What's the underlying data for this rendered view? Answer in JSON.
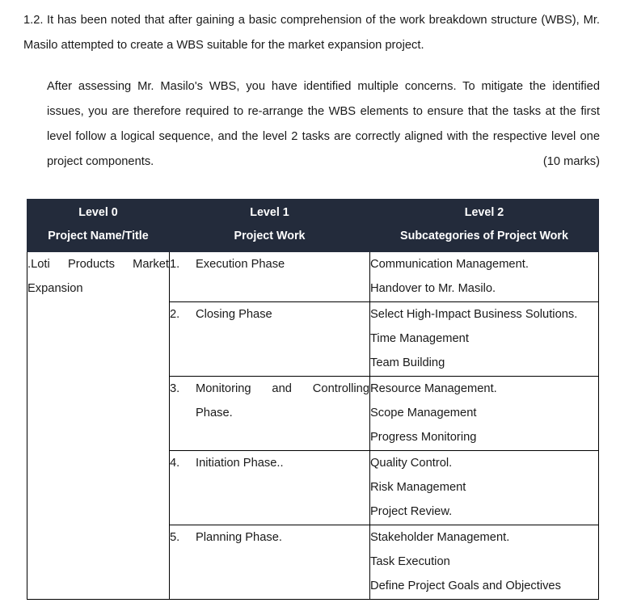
{
  "question": {
    "number": "1.2.",
    "paragraph_1": "It has been noted that after gaining a basic comprehension of the work breakdown structure (WBS), Mr. Masilo attempted to create a WBS suitable for the market expansion project.",
    "paragraph_2": "After assessing Mr. Masilo's WBS, you have identified multiple concerns. To mitigate the identified issues, you are therefore required to re-arrange the WBS elements to ensure that the tasks at the first level follow a logical sequence, and the level 2 tasks are correctly aligned with the respective level one project components.",
    "marks": "(10 marks)"
  },
  "table": {
    "header_color": "#232b3b",
    "header_text_color": "#ffffff",
    "border_color": "#000000",
    "columns": [
      {
        "level": "Level 0",
        "description": "Project Name/Title"
      },
      {
        "level": "Level 1",
        "description": "Project Work"
      },
      {
        "level": "Level 2",
        "description": "Subcategories of Project Work"
      }
    ],
    "project_name": ".Loti Products Market Expansion",
    "rows": [
      {
        "number": "1.",
        "task": "Execution Phase",
        "subcategories": [
          "Communication Management.",
          "Handover to Mr. Masilo."
        ]
      },
      {
        "number": "2.",
        "task": "Closing Phase",
        "subcategories": [
          "Select High-Impact Business Solutions.",
          "Time Management",
          "Team Building"
        ]
      },
      {
        "number": "3.",
        "task": "Monitoring and Controlling Phase.",
        "subcategories": [
          "Resource Management.",
          "Scope Management",
          "Progress Monitoring"
        ]
      },
      {
        "number": "4.",
        "task": "Initiation Phase..",
        "subcategories": [
          "Quality Control.",
          "Risk Management",
          "Project Review."
        ]
      },
      {
        "number": "5.",
        "task": "Planning Phase.",
        "subcategories": [
          "Stakeholder Management.",
          "Task Execution",
          "Define Project Goals and Objectives"
        ]
      }
    ]
  }
}
